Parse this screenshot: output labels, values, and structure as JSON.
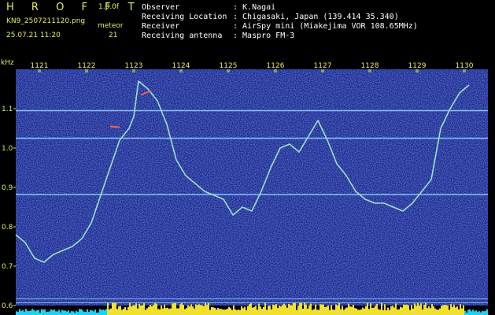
{
  "header": {
    "logo": "H R O F F T",
    "version": "1.0.0f",
    "filename": "KN9_2507211120.png",
    "datetime": "25.07.21 11:20",
    "meteor_label": "meteor",
    "meteor_count": "21",
    "info": [
      {
        "label": "Observer",
        "value": ": K.Nagai"
      },
      {
        "label": "Receiving Location",
        "value": ": Chigasaki, Japan (139.414 35.340)"
      },
      {
        "label": "Receiver",
        "value": ": AirSpy mini (Miakejima VOR 108.65MHz)"
      },
      {
        "label": "Receiving antenna",
        "value": ": Maspro FM-3"
      }
    ]
  },
  "colors": {
    "background": "#000000",
    "spectrogram_bg": "#1a2a8a",
    "text": "#e8ec60",
    "trace": "#9fe0c8",
    "carrier_line": "#8fd0ff",
    "meteor_echo": "#ff6040",
    "level_yellow": "#f0e030",
    "level_cyan": "#20d0f0"
  },
  "chart_data": {
    "type": "line",
    "ylabel": "kHz",
    "ylim": [
      0.6,
      1.2
    ],
    "xlim": [
      1120.5,
      1130.5
    ],
    "x_ticks": [
      "1121",
      "1122",
      "1123",
      "1124",
      "1125",
      "1126",
      "1127",
      "1128",
      "1129",
      "1130"
    ],
    "y_ticks": [
      "0.6",
      "0.7",
      "0.8",
      "0.9",
      "1.0",
      "1.1"
    ],
    "carrier_lines_khz": [
      1.095,
      1.025,
      0.882
    ],
    "lower_lines_khz": [
      0.617,
      0.607
    ],
    "series": [
      {
        "x": [
          1120.5,
          1120.7,
          1120.9,
          1121.1,
          1121.3,
          1121.5,
          1121.7,
          1121.9,
          1122.1,
          1122.3,
          1122.5,
          1122.7,
          1122.9,
          1123.0,
          1123.1,
          1123.3,
          1123.5,
          1123.7,
          1123.9,
          1124.1,
          1124.3,
          1124.5,
          1124.7,
          1124.9,
          1125.1,
          1125.3,
          1125.5,
          1125.7,
          1125.9,
          1126.1,
          1126.3,
          1126.5,
          1126.7,
          1126.9,
          1127.1,
          1127.3,
          1127.5,
          1127.7,
          1127.9,
          1128.1,
          1128.3,
          1128.5,
          1128.7,
          1128.9,
          1129.1,
          1129.3,
          1129.5,
          1129.7,
          1129.9,
          1130.1
        ],
        "y": [
          0.78,
          0.76,
          0.72,
          0.71,
          0.73,
          0.74,
          0.75,
          0.77,
          0.81,
          0.88,
          0.95,
          1.02,
          1.05,
          1.08,
          1.17,
          1.15,
          1.12,
          1.06,
          0.97,
          0.93,
          0.91,
          0.89,
          0.88,
          0.87,
          0.83,
          0.85,
          0.84,
          0.89,
          0.95,
          1.0,
          1.01,
          0.99,
          1.03,
          1.07,
          1.02,
          0.96,
          0.93,
          0.89,
          0.87,
          0.86,
          0.86,
          0.85,
          0.84,
          0.86,
          0.89,
          0.92,
          1.05,
          1.1,
          1.14,
          1.16
        ]
      }
    ],
    "meteor_echoes": [
      {
        "x": [
          1122.5,
          1122.7
        ],
        "y": [
          1.055,
          1.053
        ]
      },
      {
        "x": [
          1123.15,
          1123.35
        ],
        "y": [
          1.135,
          1.145
        ]
      }
    ]
  }
}
